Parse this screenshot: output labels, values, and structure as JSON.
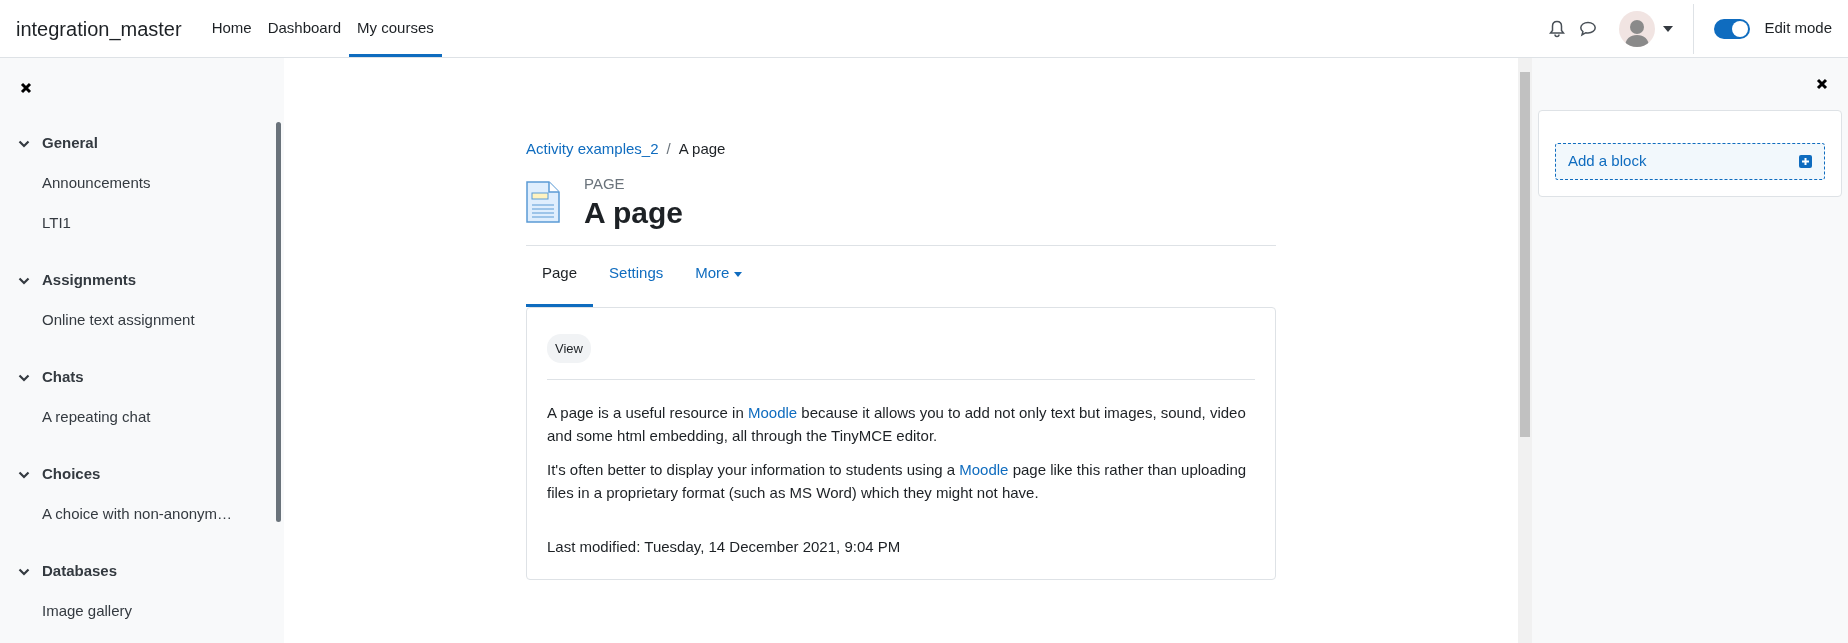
{
  "navbar": {
    "site_name": "integration_master",
    "links": [
      {
        "label": "Home",
        "selected": false
      },
      {
        "label": "Dashboard",
        "selected": false
      },
      {
        "label": "My courses",
        "selected": true
      }
    ],
    "edit_mode": {
      "label": "Edit mode",
      "on": true
    }
  },
  "course_index": {
    "sections": [
      {
        "title": "General",
        "expanded": true,
        "items": [
          "Announcements",
          "LTI1"
        ]
      },
      {
        "title": "Assignments",
        "expanded": true,
        "items": [
          "Online text assignment"
        ]
      },
      {
        "title": "Chats",
        "expanded": true,
        "items": [
          "A repeating chat"
        ]
      },
      {
        "title": "Choices",
        "expanded": true,
        "items": [
          "A choice with non-anonym…"
        ]
      },
      {
        "title": "Databases",
        "expanded": true,
        "items": [
          "Image gallery"
        ]
      }
    ]
  },
  "breadcrumb": [
    {
      "label": "Activity examples_2",
      "kind": "link"
    },
    {
      "label": "A page",
      "kind": "current",
      "separator": "/"
    }
  ],
  "header": {
    "type": "PAGE",
    "title": "A page"
  },
  "tabs": [
    {
      "label": "Page",
      "selected": true,
      "kind": "tab"
    },
    {
      "label": "Settings",
      "selected": false,
      "kind": "tab"
    },
    {
      "label": "More",
      "selected": false,
      "kind": "dropdown"
    }
  ],
  "content": {
    "view_label": "View",
    "paragraphs": [
      [
        {
          "kind": "text",
          "text": "A page is a useful resource in "
        },
        {
          "kind": "link",
          "text": "Moodle"
        },
        {
          "kind": "text",
          "text": " because it allows you to add not only text but images, sound, video and some html embedding, all through the TinyMCE editor."
        }
      ],
      [
        {
          "kind": "text",
          "text": "It's often better to display your information to students using a "
        },
        {
          "kind": "link",
          "text": "Moodle"
        },
        {
          "kind": "text",
          "text": " page like this rather than uploading files in a proprietary format (such as MS Word) which they might not have."
        }
      ]
    ],
    "last_modified": "Last modified: Tuesday, 14 December 2021, 9:04 PM"
  },
  "block_drawer": {
    "add_block": "Add a block"
  }
}
